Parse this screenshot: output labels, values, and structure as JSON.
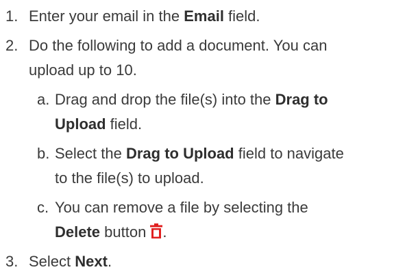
{
  "steps": [
    {
      "number": "1.",
      "text_before": "Enter your email in the ",
      "bold": "Email",
      "text_after": " field."
    },
    {
      "number": "2.",
      "line1": "Do the following to add a document. You can",
      "line2": "upload up to 10.",
      "substeps": [
        {
          "letter": "a.",
          "line1_text": "Drag and drop the file(s) into the ",
          "line1_bold": "Drag to",
          "line2_bold": "Upload",
          "line2_text": " field."
        },
        {
          "letter": "b.",
          "line1_text_before": "Select the ",
          "line1_bold": "Drag to Upload",
          "line1_text_after": " field to navigate",
          "line2_text": "to the file(s) to upload."
        },
        {
          "letter": "c.",
          "line1_text": "You can remove a file by selecting the",
          "line2_bold": "Delete",
          "line2_text": " button",
          "line2_end": ".",
          "icon": "trash-icon",
          "icon_color": "#e02020"
        }
      ]
    },
    {
      "number": "3.",
      "text_before": "Select ",
      "bold": "Next",
      "text_after": "."
    }
  ]
}
